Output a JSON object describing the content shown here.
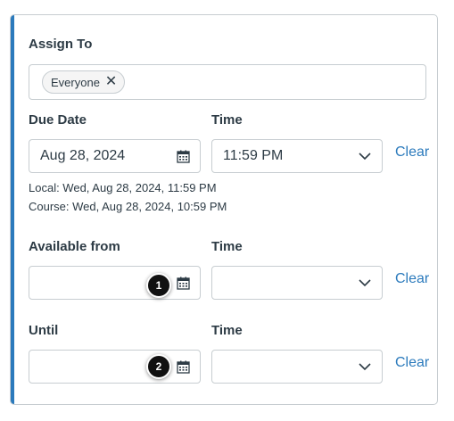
{
  "assign": {
    "label": "Assign To",
    "chips": [
      {
        "label": "Everyone",
        "remove_glyph": "✕"
      }
    ]
  },
  "due": {
    "date_label": "Due Date",
    "time_label": "Time",
    "date_value": "Aug 28, 2024",
    "time_value": "11:59 PM",
    "clear_label": "Clear",
    "local_text": "Local: Wed, Aug 28, 2024, 11:59 PM",
    "course_text": "Course: Wed, Aug 28, 2024, 10:59 PM"
  },
  "available": {
    "date_label": "Available from",
    "time_label": "Time",
    "date_value": "",
    "time_value": "",
    "clear_label": "Clear"
  },
  "until": {
    "date_label": "Until",
    "time_label": "Time",
    "date_value": "",
    "time_value": "",
    "clear_label": "Clear"
  },
  "callouts": [
    "1",
    "2"
  ],
  "icons": {
    "calendar": "calendar-icon",
    "chevron": "chevron-down-icon",
    "remove": "close-icon"
  },
  "colors": {
    "accent": "#2b7abc",
    "link": "#2b7abc",
    "text": "#2d3b45",
    "border": "#c7cdd1",
    "badge": "#111111"
  }
}
